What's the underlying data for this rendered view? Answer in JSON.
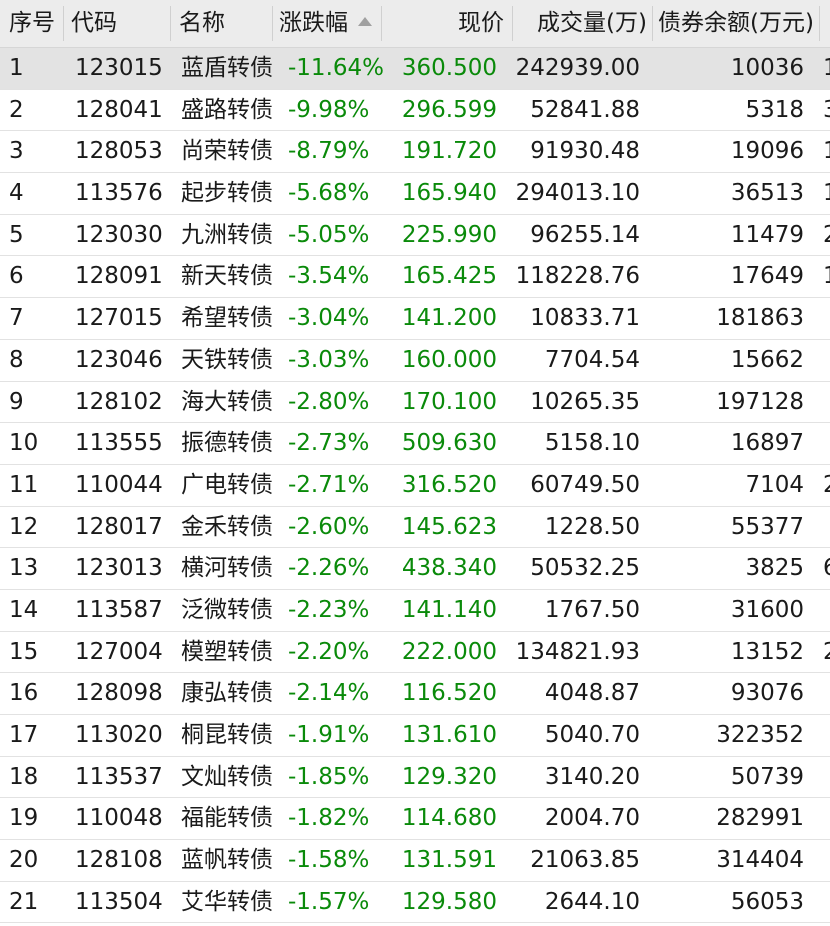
{
  "columns": {
    "index": "序号",
    "code": "代码",
    "name": "名称",
    "change": "涨跌幅",
    "price": "现价",
    "volume": "成交量(万)",
    "balance": "债券余额(万元)"
  },
  "sort": {
    "column": "change",
    "direction": "ascending",
    "icon": "sort-up-icon"
  },
  "colors": {
    "down": "#0a8a0a",
    "header_bg": "#ececec",
    "selected_bg": "#e3e3e3"
  },
  "rows": [
    {
      "index": "1",
      "code": "123015",
      "name": "蓝盾转债",
      "change": "-11.64%",
      "price": "360.500",
      "volume": "242939.00",
      "balance": "10036",
      "extra": "1"
    },
    {
      "index": "2",
      "code": "128041",
      "name": "盛路转债",
      "change": "-9.98%",
      "price": "296.599",
      "volume": "52841.88",
      "balance": "5318",
      "extra": "3"
    },
    {
      "index": "3",
      "code": "128053",
      "name": "尚荣转债",
      "change": "-8.79%",
      "price": "191.720",
      "volume": "91930.48",
      "balance": "19096",
      "extra": "1"
    },
    {
      "index": "4",
      "code": "113576",
      "name": "起步转债",
      "change": "-5.68%",
      "price": "165.940",
      "volume": "294013.10",
      "balance": "36513",
      "extra": "1"
    },
    {
      "index": "5",
      "code": "123030",
      "name": "九洲转债",
      "change": "-5.05%",
      "price": "225.990",
      "volume": "96255.14",
      "balance": "11479",
      "extra": "2"
    },
    {
      "index": "6",
      "code": "128091",
      "name": "新天转债",
      "change": "-3.54%",
      "price": "165.425",
      "volume": "118228.76",
      "balance": "17649",
      "extra": "1"
    },
    {
      "index": "7",
      "code": "127015",
      "name": "希望转债",
      "change": "-3.04%",
      "price": "141.200",
      "volume": "10833.71",
      "balance": "181863",
      "extra": ""
    },
    {
      "index": "8",
      "code": "123046",
      "name": "天铁转债",
      "change": "-3.03%",
      "price": "160.000",
      "volume": "7704.54",
      "balance": "15662",
      "extra": ""
    },
    {
      "index": "9",
      "code": "128102",
      "name": "海大转债",
      "change": "-2.80%",
      "price": "170.100",
      "volume": "10265.35",
      "balance": "197128",
      "extra": ""
    },
    {
      "index": "10",
      "code": "113555",
      "name": "振德转债",
      "change": "-2.73%",
      "price": "509.630",
      "volume": "5158.10",
      "balance": "16897",
      "extra": ""
    },
    {
      "index": "11",
      "code": "110044",
      "name": "广电转债",
      "change": "-2.71%",
      "price": "316.520",
      "volume": "60749.50",
      "balance": "7104",
      "extra": "2"
    },
    {
      "index": "12",
      "code": "128017",
      "name": "金禾转债",
      "change": "-2.60%",
      "price": "145.623",
      "volume": "1228.50",
      "balance": "55377",
      "extra": ""
    },
    {
      "index": "13",
      "code": "123013",
      "name": "横河转债",
      "change": "-2.26%",
      "price": "438.340",
      "volume": "50532.25",
      "balance": "3825",
      "extra": "6"
    },
    {
      "index": "14",
      "code": "113587",
      "name": "泛微转债",
      "change": "-2.23%",
      "price": "141.140",
      "volume": "1767.50",
      "balance": "31600",
      "extra": ""
    },
    {
      "index": "15",
      "code": "127004",
      "name": "模塑转债",
      "change": "-2.20%",
      "price": "222.000",
      "volume": "134821.93",
      "balance": "13152",
      "extra": "2"
    },
    {
      "index": "16",
      "code": "128098",
      "name": "康弘转债",
      "change": "-2.14%",
      "price": "116.520",
      "volume": "4048.87",
      "balance": "93076",
      "extra": ""
    },
    {
      "index": "17",
      "code": "113020",
      "name": "桐昆转债",
      "change": "-1.91%",
      "price": "131.610",
      "volume": "5040.70",
      "balance": "322352",
      "extra": ""
    },
    {
      "index": "18",
      "code": "113537",
      "name": "文灿转债",
      "change": "-1.85%",
      "price": "129.320",
      "volume": "3140.20",
      "balance": "50739",
      "extra": ""
    },
    {
      "index": "19",
      "code": "110048",
      "name": "福能转债",
      "change": "-1.82%",
      "price": "114.680",
      "volume": "2004.70",
      "balance": "282991",
      "extra": ""
    },
    {
      "index": "20",
      "code": "128108",
      "name": "蓝帆转债",
      "change": "-1.58%",
      "price": "131.591",
      "volume": "21063.85",
      "balance": "314404",
      "extra": ""
    },
    {
      "index": "21",
      "code": "113504",
      "name": "艾华转债",
      "change": "-1.57%",
      "price": "129.580",
      "volume": "2644.10",
      "balance": "56053",
      "extra": ""
    }
  ]
}
